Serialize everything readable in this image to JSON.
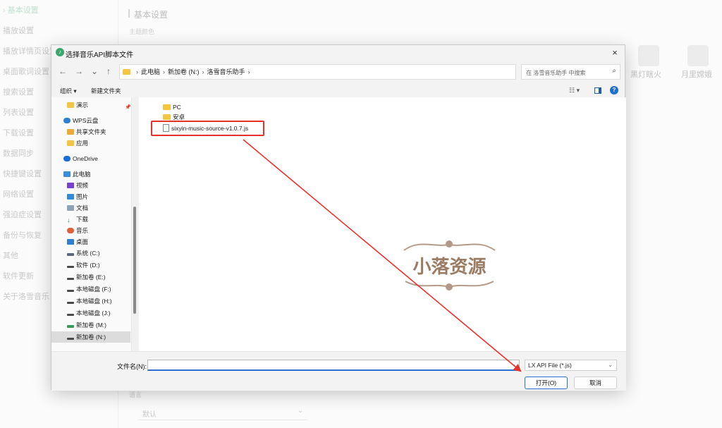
{
  "background_app": {
    "nav": [
      "› 基本设置",
      "播放设置",
      "播放详情页设置",
      "桌面歌词设置",
      "搜索设置",
      "列表设置",
      "下载设置",
      "数据同步",
      "快捷键设置",
      "网络设置",
      "强迫症设置",
      "备份与恢复",
      "其他",
      "软件更新",
      "关于洛雪音乐"
    ],
    "section_title": "基本设置",
    "theme_label": "主题颜色",
    "theme_names": [
      "黑灯瞎火",
      "月里嫦娥"
    ],
    "language_label": "语言",
    "language_value": "默认"
  },
  "dialog": {
    "title": "选择音乐API脚本文件",
    "close_glyph": "×",
    "nav_glyphs": {
      "back": "←",
      "forward": "→",
      "recent": "⌄",
      "up": "↑",
      "dropdown": "⌄",
      "refresh": "↻"
    },
    "path": [
      "此电脑",
      "新加卷 (N:)",
      "洛雪音乐助手"
    ],
    "path_sep": "›",
    "search_placeholder": "在 洛雪音乐助手 中搜索",
    "toolbar": {
      "organize": "组织 ▾",
      "new_folder": "新建文件夹",
      "view_glyph": "☷ ▾",
      "help_glyph": "?"
    },
    "nav_pane": [
      {
        "label": "演示",
        "icon": "folder-icon",
        "pinned": true
      },
      {
        "label": "WPS云盘",
        "icon": "cloud-icon"
      },
      {
        "label": "共享文件夹",
        "icon": "shared-folder-icon"
      },
      {
        "label": "应用",
        "icon": "folder-icon"
      },
      {
        "label": "OneDrive",
        "icon": "cloud-icon"
      },
      {
        "label": "此电脑",
        "icon": "computer-icon"
      },
      {
        "label": "视频",
        "icon": "video-icon"
      },
      {
        "label": "图片",
        "icon": "picture-icon"
      },
      {
        "label": "文档",
        "icon": "document-icon"
      },
      {
        "label": "下载",
        "icon": "download-icon"
      },
      {
        "label": "音乐",
        "icon": "music-icon"
      },
      {
        "label": "桌面",
        "icon": "desktop-icon"
      },
      {
        "label": "系统 (C:)",
        "icon": "drive-icon"
      },
      {
        "label": "软件 (D:)",
        "icon": "drive-icon"
      },
      {
        "label": "新加卷 (E:)",
        "icon": "drive-icon"
      },
      {
        "label": "本地磁盘 (F:)",
        "icon": "drive-icon"
      },
      {
        "label": "本地磁盘 (H:)",
        "icon": "drive-icon"
      },
      {
        "label": "本地磁盘 (J:)",
        "icon": "drive-icon"
      },
      {
        "label": "新加卷 (M:)",
        "icon": "drive-icon"
      },
      {
        "label": "新加卷 (N:)",
        "icon": "drive-icon",
        "selected": true
      }
    ],
    "files": [
      {
        "name": "PC",
        "type": "folder"
      },
      {
        "name": "安卓",
        "type": "folder"
      },
      {
        "name": "sixyin-music-source-v1.0.7.js",
        "type": "js-file",
        "highlighted": true
      }
    ],
    "watermark_text": "小落资源",
    "filename_label": "文件名(N):",
    "filename_value": "",
    "filetype_value": "LX API File (*.js)",
    "open_label": "打开(O)",
    "cancel_label": "取消"
  },
  "colors": {
    "highlight_red": "#e8312a",
    "accent_blue": "#2a6fd1",
    "folder_yellow": "#f5c542"
  }
}
